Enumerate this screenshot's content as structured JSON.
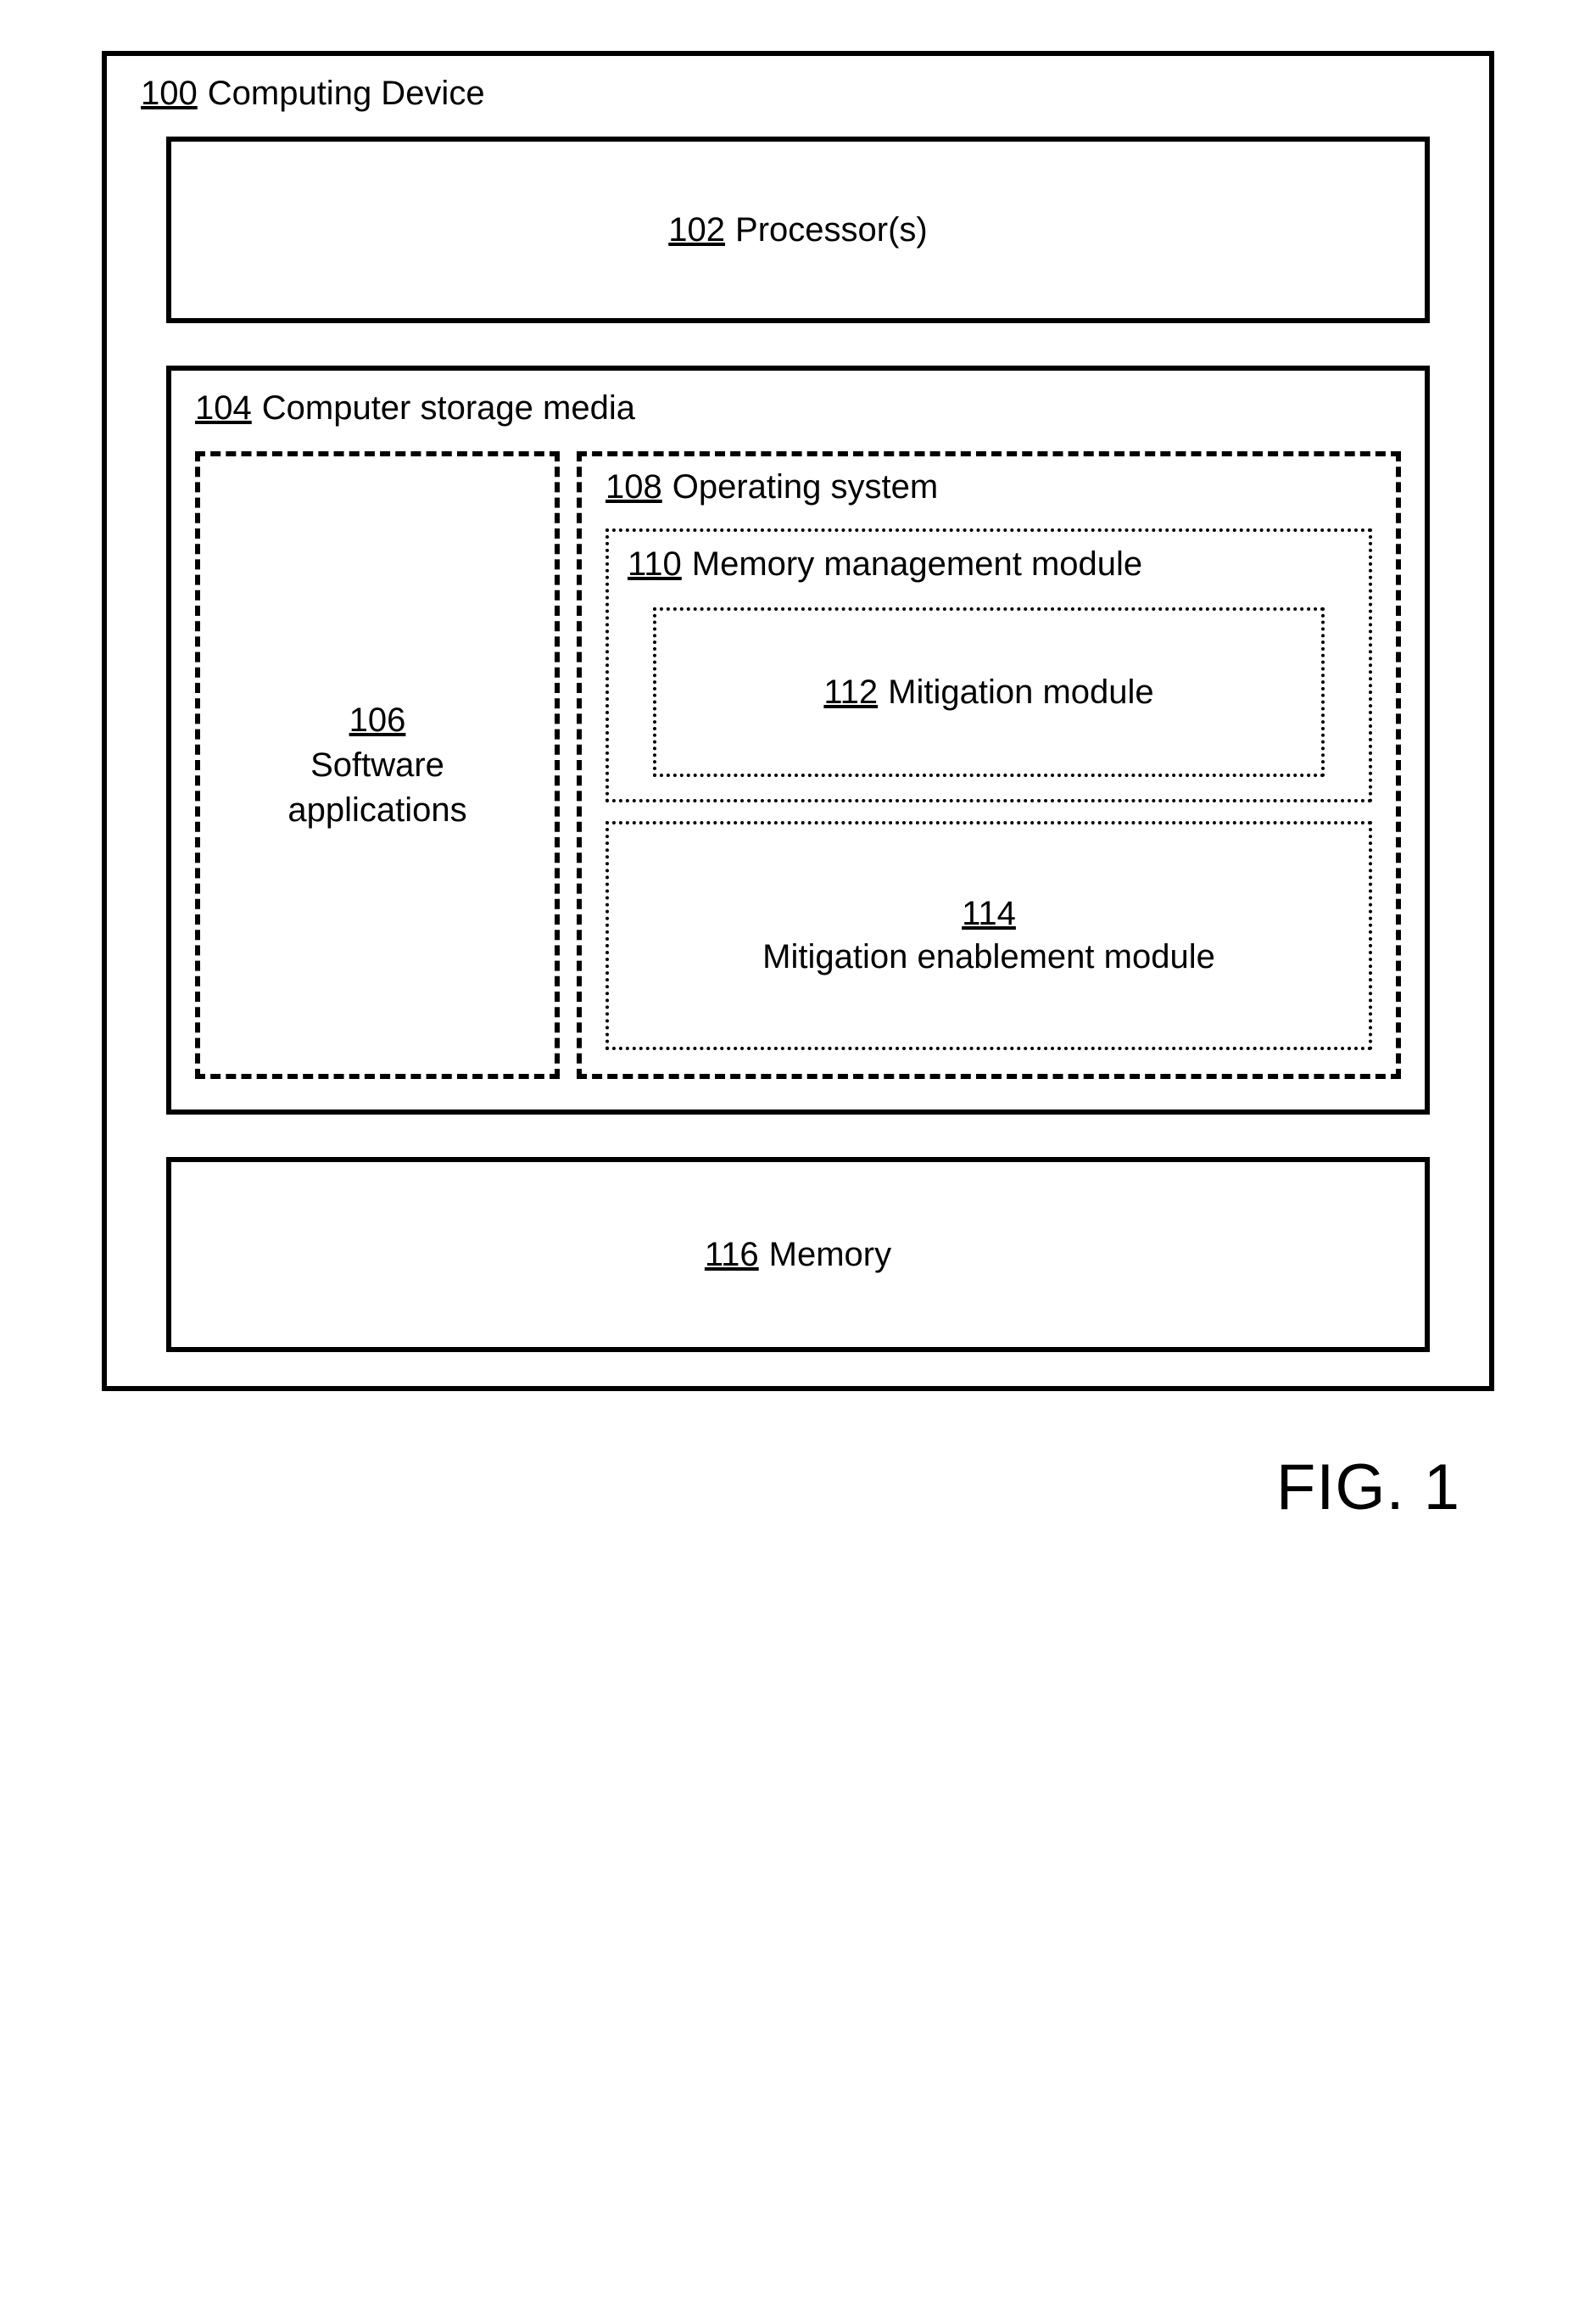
{
  "device": {
    "ref": "100",
    "label": "Computing Device"
  },
  "processor": {
    "ref": "102",
    "label": "Processor(s)"
  },
  "storage": {
    "ref": "104",
    "label": "Computer storage media"
  },
  "software": {
    "ref": "106",
    "label1": "Software",
    "label2": "applications"
  },
  "os": {
    "ref": "108",
    "label": "Operating system"
  },
  "memmgmt": {
    "ref": "110",
    "label": "Memory management module"
  },
  "mitmod": {
    "ref": "112",
    "label": "Mitigation module"
  },
  "mitenable": {
    "ref": "114",
    "label": "Mitigation enablement module"
  },
  "memory": {
    "ref": "116",
    "label": "Memory"
  },
  "figure": {
    "prefix": "FIG.",
    "num": "1"
  }
}
